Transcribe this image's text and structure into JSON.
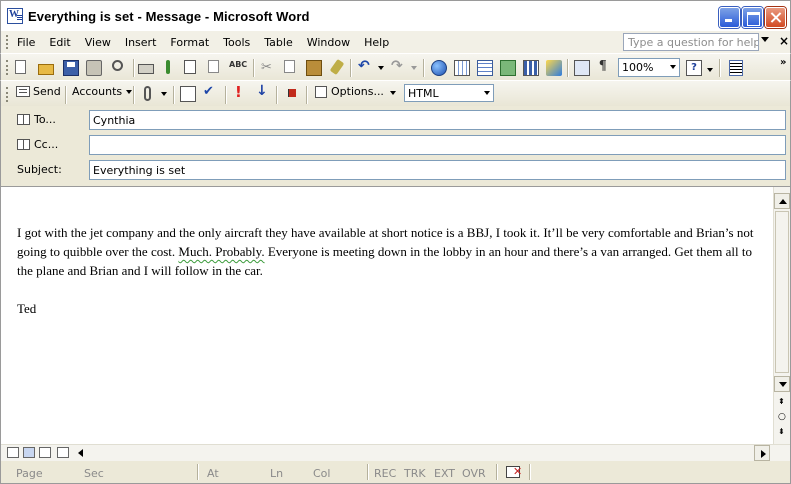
{
  "window": {
    "title": "Everything is set - Message - Microsoft Word"
  },
  "menu": {
    "items": [
      "File",
      "Edit",
      "View",
      "Insert",
      "Format",
      "Tools",
      "Table",
      "Window",
      "Help"
    ],
    "ask_placeholder": "Type a question for help"
  },
  "toolbar": {
    "zoom": "100%"
  },
  "message_toolbar": {
    "send_label": "Send",
    "accounts_label": "Accounts",
    "options_label": "Options...",
    "format_value": "HTML"
  },
  "envelope": {
    "to_label": "To...",
    "to_value": "Cynthia",
    "cc_label": "Cc...",
    "cc_value": "",
    "subject_label": "Subject:",
    "subject_value": "Everything is set"
  },
  "body": {
    "para1_a": "I got with the jet company and the only aircraft they have available at short notice is a BBJ, I took it. It’ll be very comfortable and Brian’s not going to quibble over the cost. ",
    "para1_wavy": "Much. Probably.",
    "para1_b": " Everyone is meeting down in the lobby in an hour and there’s a van arranged. Get them all to the plane and Brian and I will follow in the car.",
    "signature": "Ted"
  },
  "status": {
    "page": "Page",
    "sec": "Sec",
    "at": "At",
    "ln": "Ln",
    "col": "Col",
    "rec": "REC",
    "trk": "TRK",
    "ext": "EXT",
    "ovr": "OVR"
  },
  "colors": {
    "chrome": "#ece9d8",
    "spell_underline": "#3a9a3a",
    "close_button": "#d24a23"
  }
}
